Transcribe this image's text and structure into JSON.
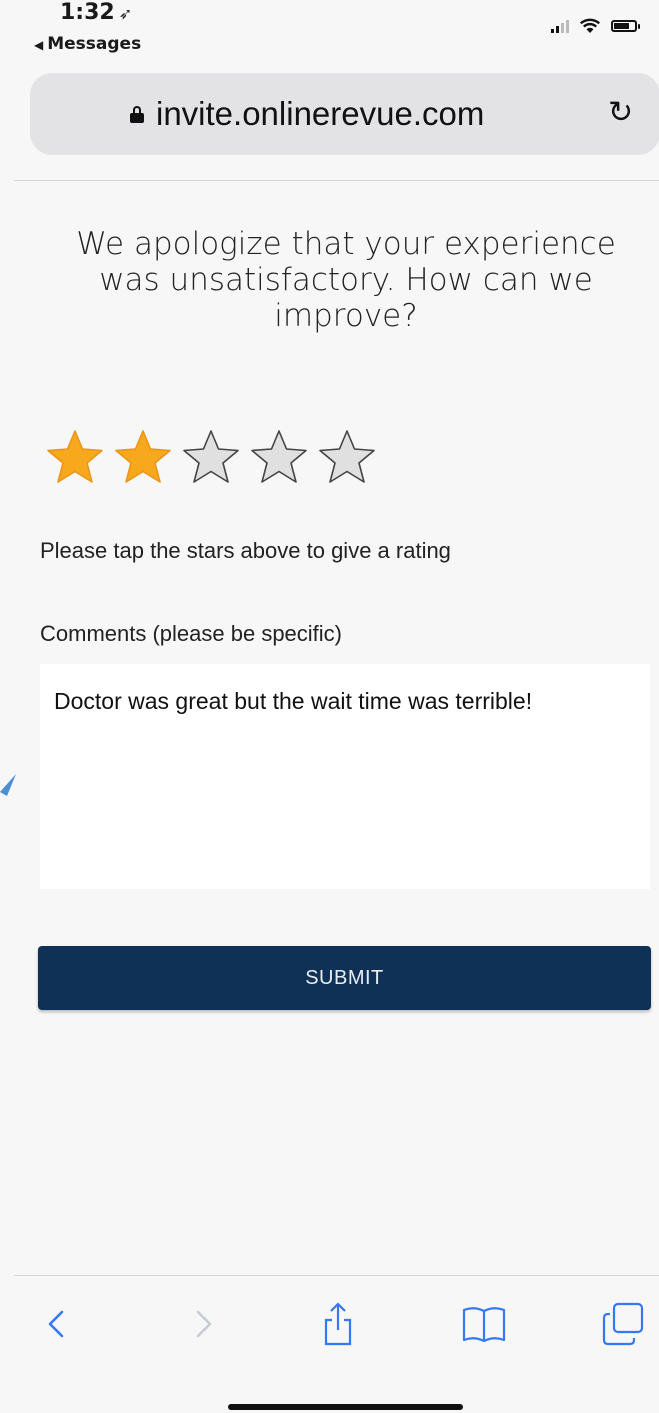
{
  "status_bar": {
    "time": "1:32",
    "location_arrow": "location-arrow-icon",
    "back_app_label": "Messages"
  },
  "browser": {
    "url": "invite.onlinerevue.com",
    "lock_icon": "lock-icon",
    "reload_icon": "reload-icon"
  },
  "page": {
    "heading": "We apologize that your experience was unsatisfactory. How can we improve?",
    "rating": {
      "value": 2,
      "max": 5,
      "filled_color": "#f7a81c",
      "empty_color": "#e0e0e0"
    },
    "rating_hint": "Please tap the stars above to give a rating",
    "comments_label": "Comments (please be specific)",
    "comments_value": "Doctor was great but the wait time was terrible!",
    "submit_label": "SUBMIT",
    "submit_color": "#0e3155"
  },
  "toolbar": {
    "icons": [
      "back-chevron-icon",
      "forward-chevron-icon",
      "share-icon",
      "bookmarks-icon",
      "tabs-icon"
    ],
    "accent_color": "#3478f6"
  }
}
